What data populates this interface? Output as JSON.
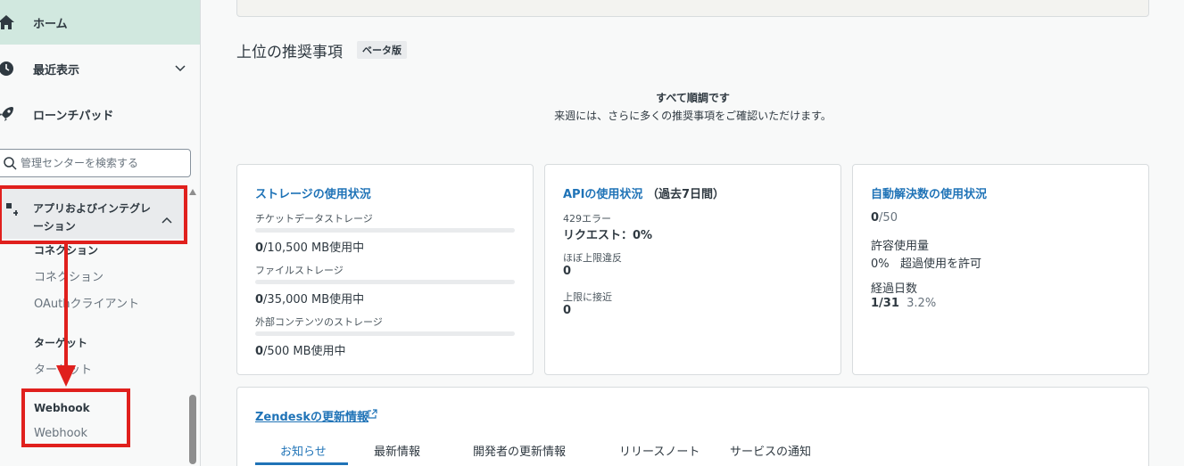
{
  "sidebar": {
    "home_label": "ホーム",
    "recent_label": "最近表示",
    "launchpad_label": "ローンチパッド",
    "search_placeholder": "管理センターを検索する",
    "apps_label": "アプリおよびインテグレーション",
    "connections_header": "コネクション",
    "connections_link": "コネクション",
    "oauth_link": "OAuthクライアント",
    "targets_header": "ターゲット",
    "targets_link": "ターゲット",
    "webhook_header": "Webhook",
    "webhook_link": "Webhook"
  },
  "recommendations": {
    "title": "上位の推奨事項",
    "beta_badge": "ベータ版",
    "all_good": "すべて順調です",
    "all_good_sub": "来週には、さらに多くの推奨事項をご確認いただけます。"
  },
  "storage_card": {
    "title": "ストレージの使用状況",
    "items": [
      {
        "label": "チケットデータストレージ",
        "used": "0",
        "total": "/10,500 MB使用中",
        "fraction": 0
      },
      {
        "label": "ファイルストレージ",
        "used": "0",
        "total": "/35,000 MB使用中",
        "fraction": 0
      },
      {
        "label": "外部コンテンツのストレージ",
        "used": "0",
        "total": "/500 MB使用中",
        "fraction": 0
      }
    ]
  },
  "api_card": {
    "title": "APIの使用状況",
    "period": "（過去7日間）",
    "error_label": "429エラー",
    "error_value": "リクエスト：0%",
    "near_label": "ほぼ上限違反",
    "near_value": "0",
    "approach_label": "上限に接近",
    "approach_value": "0"
  },
  "auto_card": {
    "title": "自動解決数の使用状況",
    "count_used": "0",
    "count_total": "/50",
    "allowed_label": "許容使用量",
    "allowed_value": "0%",
    "allowed_note": "超過使用を許可",
    "days_label": "経過日数",
    "days_value": "1/31",
    "days_percent": "3.2%"
  },
  "news": {
    "title": "Zendeskの更新情報",
    "tabs": [
      "お知らせ",
      "最新情報",
      "開発者の更新情報",
      "リリースノート",
      "サービスの通知"
    ]
  },
  "colors": {
    "accent": "#1f73b7",
    "highlight": "#e0201d",
    "home_bg": "#d1e8df"
  }
}
